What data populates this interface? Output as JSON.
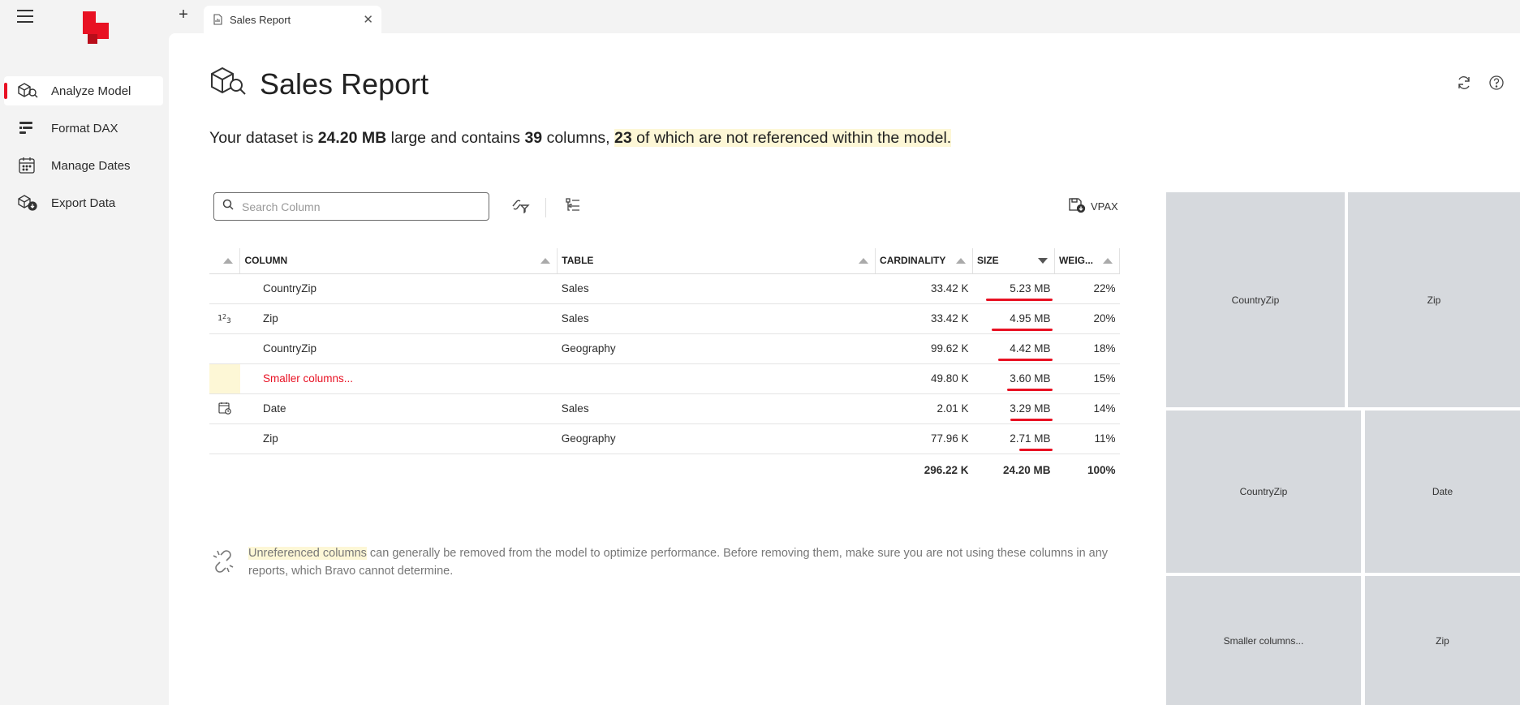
{
  "sidebar": {
    "items": [
      {
        "label": "Analyze Model",
        "icon": "analyze-model-icon",
        "active": true
      },
      {
        "label": "Format DAX",
        "icon": "format-dax-icon",
        "active": false
      },
      {
        "label": "Manage Dates",
        "icon": "manage-dates-icon",
        "active": false
      },
      {
        "label": "Export Data",
        "icon": "export-data-icon",
        "active": false
      }
    ]
  },
  "tabs": {
    "new_tab_label": "+",
    "items": [
      {
        "label": "Sales Report",
        "close": "✕"
      }
    ]
  },
  "page": {
    "title": "Sales Report",
    "summary": {
      "p1": "Your dataset is ",
      "size": "24.20 MB",
      "p2": " large and contains ",
      "columns": "39",
      "p3": " columns, ",
      "unref_count": "23",
      "p4": " of which are not referenced within the model."
    }
  },
  "toolbar": {
    "search_placeholder": "Search Column",
    "vpax_label": "VPAX"
  },
  "table": {
    "headers": {
      "column": "COLUMN",
      "table": "TABLE",
      "cardinality": "CARDINALITY",
      "size": "SIZE",
      "weight": "WEIG..."
    },
    "sort_column": "size",
    "rows": [
      {
        "type": "",
        "column": "CountryZip",
        "table": "Sales",
        "cardinality": "33.42 K",
        "size": "5.23 MB",
        "weight": "22%",
        "weight_value": 0.22
      },
      {
        "type": "number",
        "column": "Zip",
        "table": "Sales",
        "cardinality": "33.42 K",
        "size": "4.95 MB",
        "weight": "20%",
        "weight_value": 0.2
      },
      {
        "type": "",
        "column": "CountryZip",
        "table": "Geography",
        "cardinality": "99.62 K",
        "size": "4.42 MB",
        "weight": "18%",
        "weight_value": 0.18
      },
      {
        "type": "",
        "column": "Smaller columns...",
        "table": "",
        "cardinality": "49.80 K",
        "size": "3.60 MB",
        "weight": "15%",
        "weight_value": 0.15
      },
      {
        "type": "date",
        "column": "Date",
        "table": "Sales",
        "cardinality": "2.01 K",
        "size": "3.29 MB",
        "weight": "14%",
        "weight_value": 0.14
      },
      {
        "type": "",
        "column": "Zip",
        "table": "Geography",
        "cardinality": "77.96 K",
        "size": "2.71 MB",
        "weight": "11%",
        "weight_value": 0.11
      }
    ],
    "total": {
      "cardinality": "296.22 K",
      "size": "24.20 MB",
      "weight": "100%"
    }
  },
  "note": {
    "highlight": "Unreferenced columns",
    "text": " can generally be removed from the model to optimize performance. Before removing them, make sure you are not using these columns in any reports, which Bravo cannot determine."
  },
  "treemap": {
    "tiles": [
      {
        "label": "CountryZip"
      },
      {
        "label": "Zip"
      },
      {
        "label": "CountryZip"
      },
      {
        "label": "Date"
      },
      {
        "label": "Smaller columns..."
      },
      {
        "label": "Zip"
      }
    ]
  },
  "colors": {
    "accent": "#e81123",
    "highlight": "#fdf7d6",
    "tile": "#d6d9dd"
  }
}
